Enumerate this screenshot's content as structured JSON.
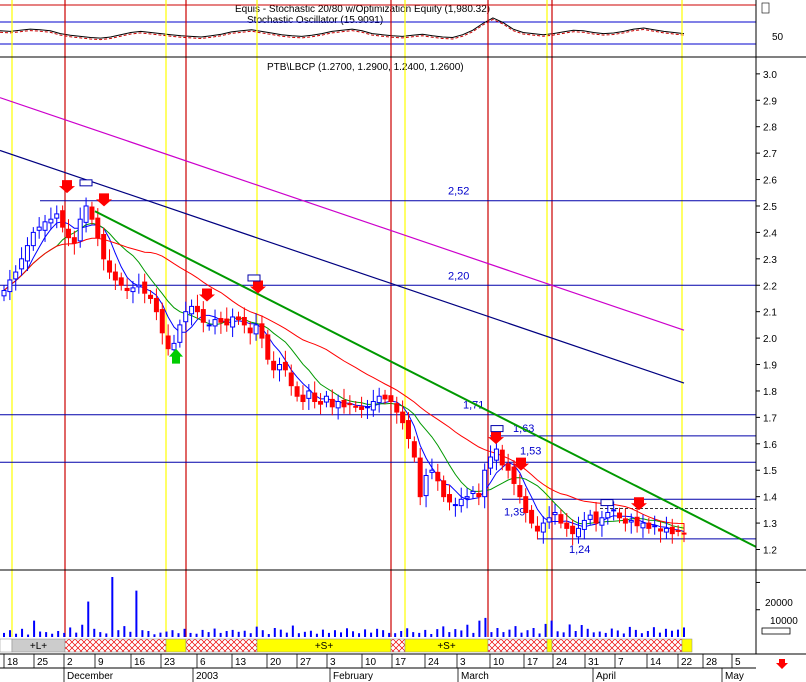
{
  "chart_data": [
    {
      "type": "line",
      "panel": "indicator",
      "title": "Equis - Stochastic 20/80 w/Optimization Equity (1,980.32)",
      "subtitle": "Stochastic Oscillator (15.9091)",
      "y_ticks": [
        50
      ],
      "series_values": [
        45,
        44,
        46,
        48,
        47,
        45,
        40,
        37,
        35,
        33,
        32,
        34,
        38,
        42,
        44,
        42,
        40,
        38,
        36,
        35,
        34,
        36,
        39,
        43,
        45,
        47,
        44,
        41,
        38,
        36,
        35,
        37,
        40,
        44,
        46,
        48,
        45,
        40,
        38,
        36,
        35,
        37,
        39,
        36,
        34,
        33,
        38,
        46,
        58,
        68,
        60,
        48,
        42,
        40,
        38,
        40,
        43,
        46,
        45,
        42,
        40,
        41,
        44,
        48,
        50,
        47,
        44,
        42,
        40
      ]
    },
    {
      "type": "candlestick",
      "panel": "price",
      "title": "PTB\\LBCP (1.2700, 1.2900, 1.2400, 1.2600)",
      "y_ticks": [
        "3.0",
        "2.9",
        "2.8",
        "2.7",
        "2.6",
        "2.5",
        "2.4",
        "2.3",
        "2.2",
        "2.1",
        "2.0",
        "1.9",
        "1.8",
        "1.7",
        "1.6",
        "1.5",
        "1.4",
        "1.3",
        "1.2"
      ],
      "ylim": [
        1.13,
        3.06
      ],
      "close_prices": [
        2.18,
        2.22,
        2.25,
        2.3,
        2.35,
        2.4,
        2.42,
        2.44,
        2.45,
        2.47,
        2.42,
        2.38,
        2.36,
        2.45,
        2.5,
        2.45,
        2.38,
        2.3,
        2.25,
        2.22,
        2.2,
        2.18,
        2.19,
        2.2,
        2.17,
        2.15,
        2.1,
        2.02,
        1.96,
        1.98,
        2.05,
        2.1,
        2.12,
        2.1,
        2.06,
        2.05,
        2.07,
        2.06,
        2.05,
        2.08,
        2.07,
        2.05,
        2.02,
        2.05,
        2.0,
        1.92,
        1.88,
        1.9,
        1.88,
        1.82,
        1.78,
        1.76,
        1.8,
        1.76,
        1.75,
        1.78,
        1.74,
        1.76,
        1.74,
        1.75,
        1.74,
        1.73,
        1.74,
        1.76,
        1.78,
        1.77,
        1.76,
        1.72,
        1.68,
        1.62,
        1.55,
        1.4,
        1.48,
        1.5,
        1.46,
        1.4,
        1.38,
        1.37,
        1.39,
        1.4,
        1.42,
        1.4,
        1.5,
        1.55,
        1.58,
        1.52,
        1.5,
        1.45,
        1.4,
        1.34,
        1.3,
        1.27,
        1.3,
        1.32,
        1.34,
        1.3,
        1.28,
        1.26,
        1.28,
        1.31,
        1.33,
        1.3,
        1.32,
        1.34,
        1.35,
        1.32,
        1.3,
        1.31,
        1.29,
        1.3,
        1.28,
        1.29,
        1.27,
        1.28,
        1.26,
        1.27,
        1.26
      ],
      "level_labels": [
        "2,52",
        "2,20",
        "1,71",
        "1,63",
        "1,53",
        "1,39",
        "1,24"
      ],
      "level_values": [
        2.52,
        2.2,
        1.71,
        1.63,
        1.53,
        1.39,
        1.24
      ]
    },
    {
      "type": "bar",
      "panel": "volume",
      "y_ticks": [
        "20000",
        "10000"
      ],
      "series_values": [
        1500,
        2500,
        1200,
        3000,
        900,
        6000,
        2000,
        1800,
        1200,
        2200,
        1500,
        3500,
        1600,
        4500,
        13000,
        3000,
        1800,
        1300,
        22000,
        2500,
        4000,
        1900,
        17000,
        2500,
        2200,
        1000,
        1600,
        2000,
        2500,
        1400,
        3000,
        1500,
        1200,
        2600,
        1800,
        3100,
        1500,
        2200,
        2600,
        1900,
        2300,
        1400,
        3800,
        2500,
        1100,
        3300,
        2700,
        1600,
        4200,
        1400,
        1900,
        2300,
        1200,
        2700,
        1500,
        2500,
        1700,
        3200,
        2100,
        1400,
        2800,
        1600,
        3000,
        2500,
        1500,
        1400,
        2200,
        3200,
        1800,
        1500,
        2600,
        1100,
        2900,
        3900,
        1800,
        2900,
        2400,
        4500,
        1500,
        6000,
        7000,
        1800,
        3300,
        1800,
        2700,
        4000,
        1600,
        2500,
        3300,
        1300,
        4800,
        6000,
        2100,
        1700,
        4600,
        2200,
        4400,
        3000,
        1700,
        2000,
        1500,
        3100,
        2400,
        1300,
        3700,
        2600,
        1400,
        2200,
        3600,
        1600,
        3000,
        2300,
        2700,
        3500
      ]
    }
  ],
  "time_axis": {
    "day_labels": [
      "18",
      "25",
      "2",
      "9",
      "16",
      "23",
      "6",
      "13",
      "20",
      "27",
      "3",
      "10",
      "17",
      "24",
      "3",
      "10",
      "17",
      "24",
      "31",
      "7",
      "14",
      "22",
      "28",
      "5"
    ],
    "month_labels": [
      "December",
      "2003",
      "February",
      "March",
      "April",
      "May"
    ]
  },
  "signal_strip": {
    "labels": [
      "+L+",
      "+S+",
      "+S+"
    ]
  },
  "colors": {
    "up_candle": "#0000ff",
    "down_candle": "#ff0000",
    "trendline": "#009900",
    "ma_fast": "#0000ff",
    "ma_medium": "#009900",
    "ma_slow": "#ff0000",
    "ma_200": "#000080",
    "ma_magenta": "#cc00cc",
    "exit_line": "#cc0000",
    "entry_line": "#ffff00"
  }
}
